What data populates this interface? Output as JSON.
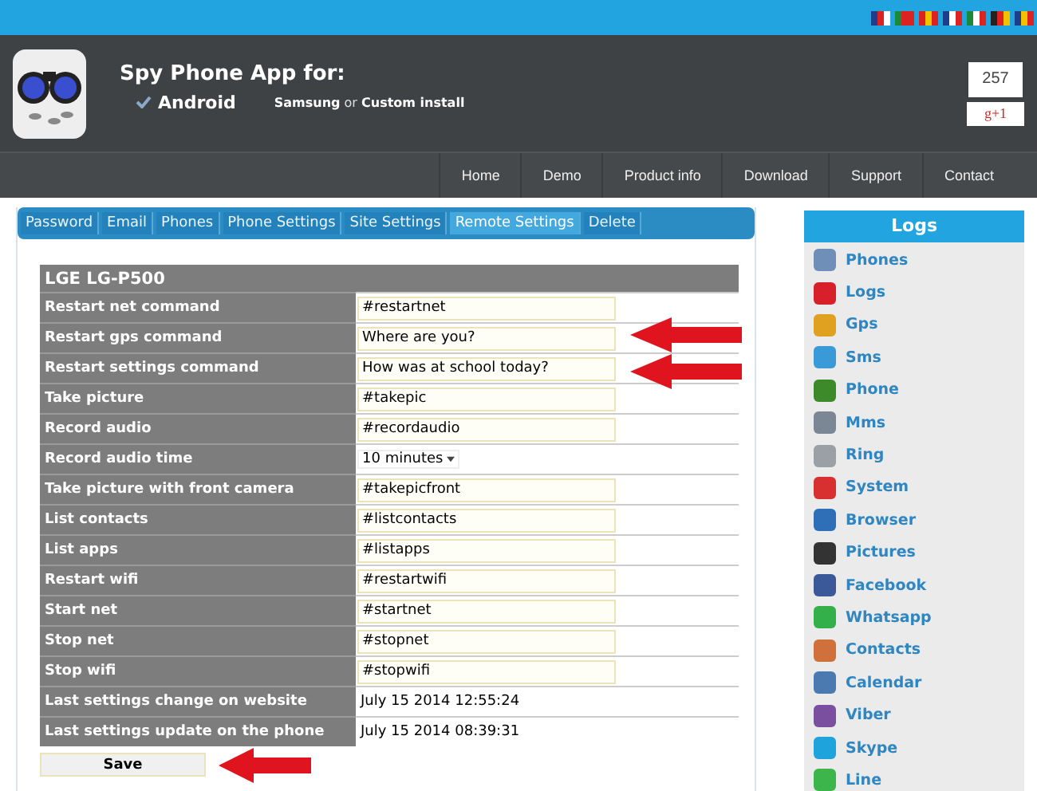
{
  "header": {
    "title": "Spy Phone App for:",
    "platform": "Android",
    "install_note": "**Samsung** or **Custom install**",
    "counter": "257",
    "plus_button": "g+1"
  },
  "nav": [
    {
      "label": "Home"
    },
    {
      "label": "Demo"
    },
    {
      "label": "Product info"
    },
    {
      "label": "Download"
    },
    {
      "label": "Support"
    },
    {
      "label": "Contact"
    }
  ],
  "tabs": [
    {
      "label": "Password",
      "selected": false
    },
    {
      "label": "Email",
      "selected": false
    },
    {
      "label": "Phones",
      "selected": false
    },
    {
      "label": "Phone Settings",
      "selected": false
    },
    {
      "label": "Site Settings",
      "selected": false
    },
    {
      "label": "Remote Settings",
      "selected": true
    },
    {
      "label": "Delete",
      "selected": false
    }
  ],
  "form": {
    "title": "LGE LG-P500",
    "rows": [
      {
        "label": "Restart net command",
        "kind": "input",
        "value": "#restartnet"
      },
      {
        "label": "Restart gps command",
        "kind": "input",
        "value": "Where are you?"
      },
      {
        "label": "Restart settings command",
        "kind": "input",
        "value": "How was at school today?"
      },
      {
        "label": "Take picture",
        "kind": "input",
        "value": "#takepic"
      },
      {
        "label": "Record audio",
        "kind": "input",
        "value": "#recordaudio"
      },
      {
        "label": "Record audio time",
        "kind": "select",
        "value": "10 minutes"
      },
      {
        "label": "Take picture with front camera",
        "kind": "input",
        "value": "#takepicfront"
      },
      {
        "label": "List contacts",
        "kind": "input",
        "value": "#listcontacts"
      },
      {
        "label": "List apps",
        "kind": "input",
        "value": "#listapps"
      },
      {
        "label": "Restart wifi",
        "kind": "input",
        "value": "#restartwifi"
      },
      {
        "label": "Start net",
        "kind": "input",
        "value": "#startnet"
      },
      {
        "label": "Stop net",
        "kind": "input",
        "value": "#stopnet"
      },
      {
        "label": "Stop wifi",
        "kind": "input",
        "value": "#stopwifi"
      },
      {
        "label": "Last settings change on website",
        "kind": "text",
        "value": "July 15 2014 12:55:24"
      },
      {
        "label": "Last settings update on the phone",
        "kind": "text",
        "value": "July 15 2014 08:39:31"
      }
    ],
    "save_button": "Save"
  },
  "sidebar": {
    "title": "Logs",
    "items": [
      {
        "label": "Phones",
        "color": "#6f8fb8"
      },
      {
        "label": "Logs",
        "color": "#d8202a"
      },
      {
        "label": "Gps",
        "color": "#e0a020"
      },
      {
        "label": "Sms",
        "color": "#3a9ad8"
      },
      {
        "label": "Phone",
        "color": "#3d8a2a"
      },
      {
        "label": "Mms",
        "color": "#7b8794"
      },
      {
        "label": "Ring",
        "color": "#9aa0a6"
      },
      {
        "label": "System",
        "color": "#d83030"
      },
      {
        "label": "Browser",
        "color": "#2f6fb8"
      },
      {
        "label": "Pictures",
        "color": "#333333"
      },
      {
        "label": "Facebook",
        "color": "#3b5998"
      },
      {
        "label": "Whatsapp",
        "color": "#34b04a"
      },
      {
        "label": "Contacts",
        "color": "#d0703a"
      },
      {
        "label": "Calendar",
        "color": "#4a7ab0"
      },
      {
        "label": "Viber",
        "color": "#7b4fa0"
      },
      {
        "label": "Skype",
        "color": "#1fa3dc"
      },
      {
        "label": "Line",
        "color": "#3cb64a"
      }
    ]
  }
}
